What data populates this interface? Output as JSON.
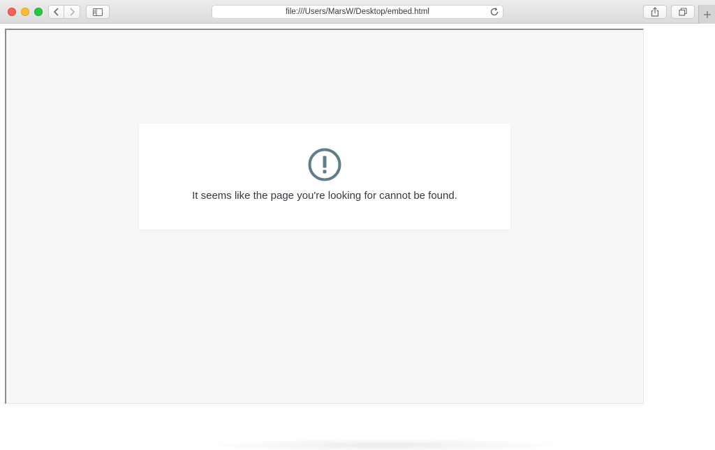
{
  "browser": {
    "address_bar": {
      "url": "file:///Users/MarsW/Desktop/embed.html"
    },
    "icons": {
      "back": "chevron-left-icon",
      "forward": "chevron-right-icon",
      "sidebar": "sidebar-icon",
      "reload": "reload-icon",
      "share": "share-icon",
      "tabs": "tabs-overview-icon",
      "new_tab": "plus-icon"
    }
  },
  "page": {
    "error_message": "It seems like the page you're looking for cannot be found.",
    "icon": "exclamation-circle-icon",
    "icon_color": "#607d8b",
    "background_color": "#f5f7f9"
  }
}
